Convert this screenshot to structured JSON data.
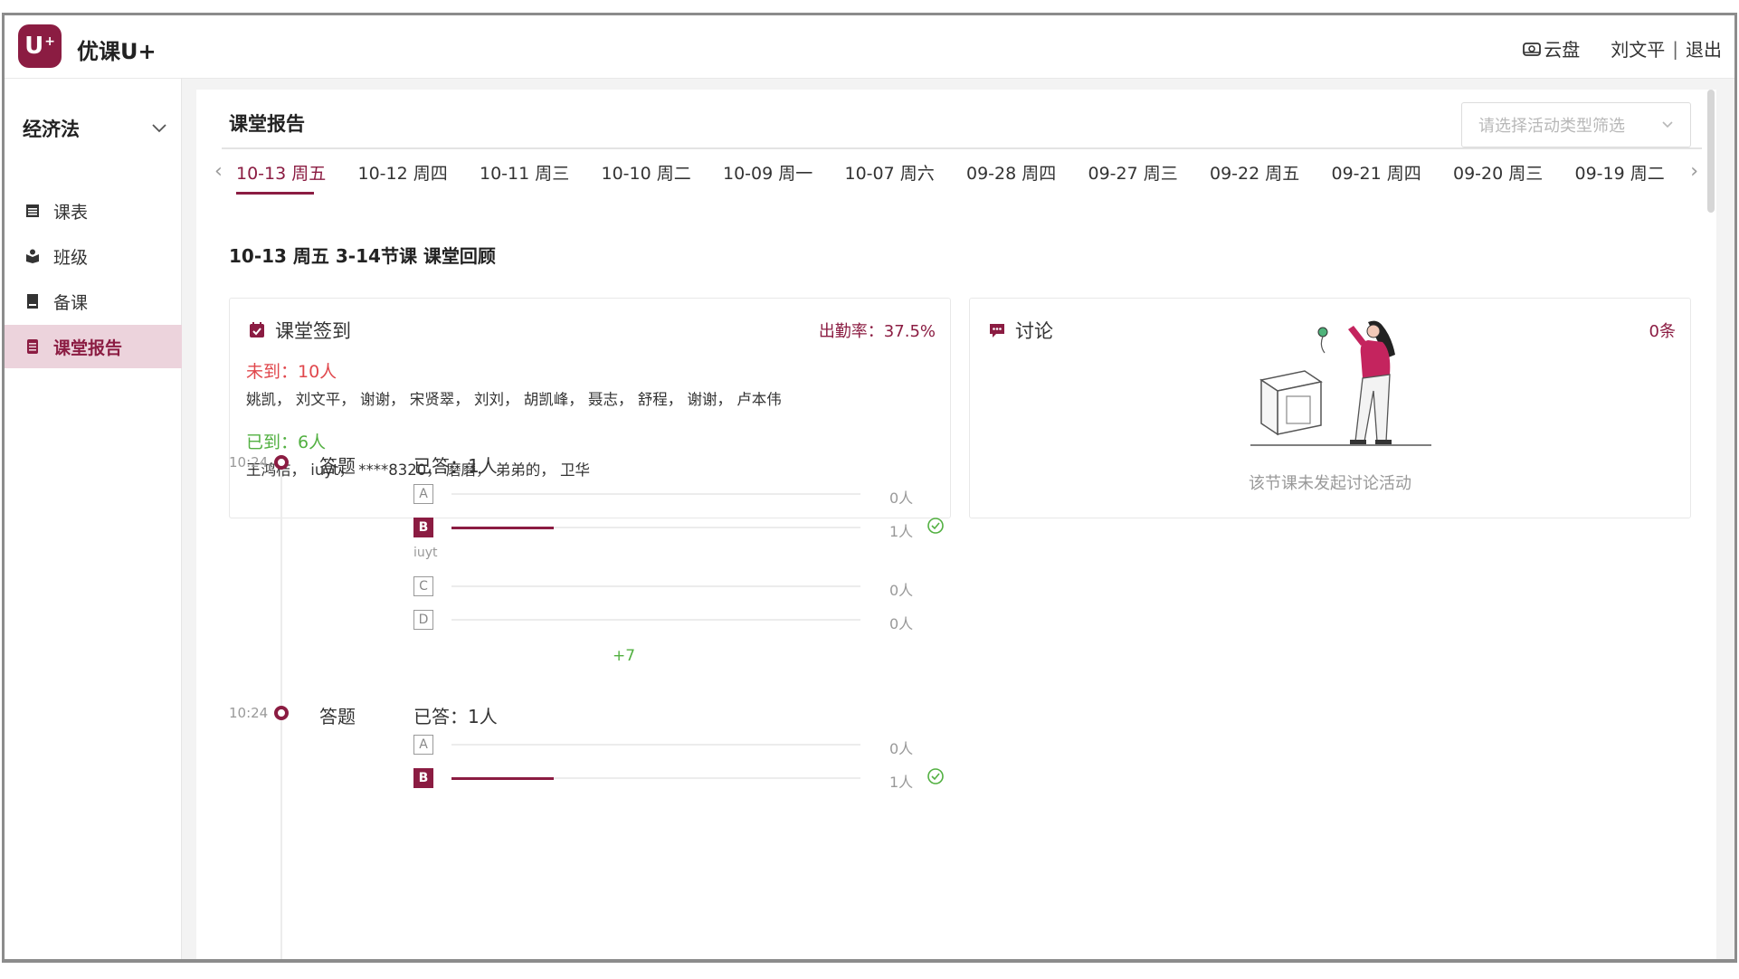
{
  "header": {
    "logo_text": "U",
    "logo_sup": "+",
    "app_name": "优课U+",
    "cloud_label": "云盘",
    "user_name": "刘文平",
    "separator": "|",
    "logout": "退出"
  },
  "sidebar": {
    "course": "经济法",
    "items": [
      {
        "label": "课表",
        "icon": "timetable-icon"
      },
      {
        "label": "班级",
        "icon": "class-icon"
      },
      {
        "label": "备课",
        "icon": "book-icon"
      },
      {
        "label": "课堂报告",
        "icon": "report-icon",
        "active": true
      }
    ]
  },
  "main": {
    "title": "课堂报告",
    "filter_placeholder": "请选择活动类型筛选",
    "prev_arrow": "‹",
    "next_arrow": "›",
    "date_tabs": [
      "10-13 周五",
      "10-12 周四",
      "10-11 周三",
      "10-10 周二",
      "10-09 周一",
      "10-07 周六",
      "09-28 周四",
      "09-27 周三",
      "09-22 周五",
      "09-21 周四",
      "09-20 周三",
      "09-19 周二"
    ],
    "review_title": "10-13 周五 3-14节课 课堂回顾"
  },
  "signin": {
    "title": "课堂签到",
    "attendance": "出勤率：37.5%",
    "absent_label": "未到：10人",
    "absent_names": "姚凯，  刘文平，  谢谢，  宋贤翠，  刘刘，  胡凯峰，  聂志，  舒程，  谢谢，  卢本伟",
    "present_label": "已到：6人",
    "present_names": "王鸿桔，  iuyt，  ****8320，  磨磨，  弟弟的，  卫华"
  },
  "discussion": {
    "title": "讨论",
    "count": "0条",
    "empty_text": "该节课未发起讨论活动"
  },
  "questions": [
    {
      "time": "10:24",
      "type": "答题",
      "answered": "已答：1人",
      "options": [
        {
          "key": "A",
          "count": "0人",
          "ratio": 0,
          "correct": false,
          "names": ""
        },
        {
          "key": "B",
          "count": "1人",
          "ratio": 0.25,
          "correct": true,
          "names": "iuyt"
        },
        {
          "key": "C",
          "count": "0人",
          "ratio": 0,
          "correct": false,
          "names": ""
        },
        {
          "key": "D",
          "count": "0人",
          "ratio": 0,
          "correct": false,
          "names": ""
        }
      ],
      "more": "+7"
    },
    {
      "time": "10:24",
      "type": "答题",
      "answered": "已答：1人",
      "options": [
        {
          "key": "A",
          "count": "0人",
          "ratio": 0,
          "correct": false,
          "names": ""
        },
        {
          "key": "B",
          "count": "1人",
          "ratio": 0.25,
          "correct": true,
          "names": ""
        }
      ]
    }
  ],
  "colors": {
    "brand": "#8b1c42",
    "absent": "#e0474c",
    "present": "#52b041"
  }
}
